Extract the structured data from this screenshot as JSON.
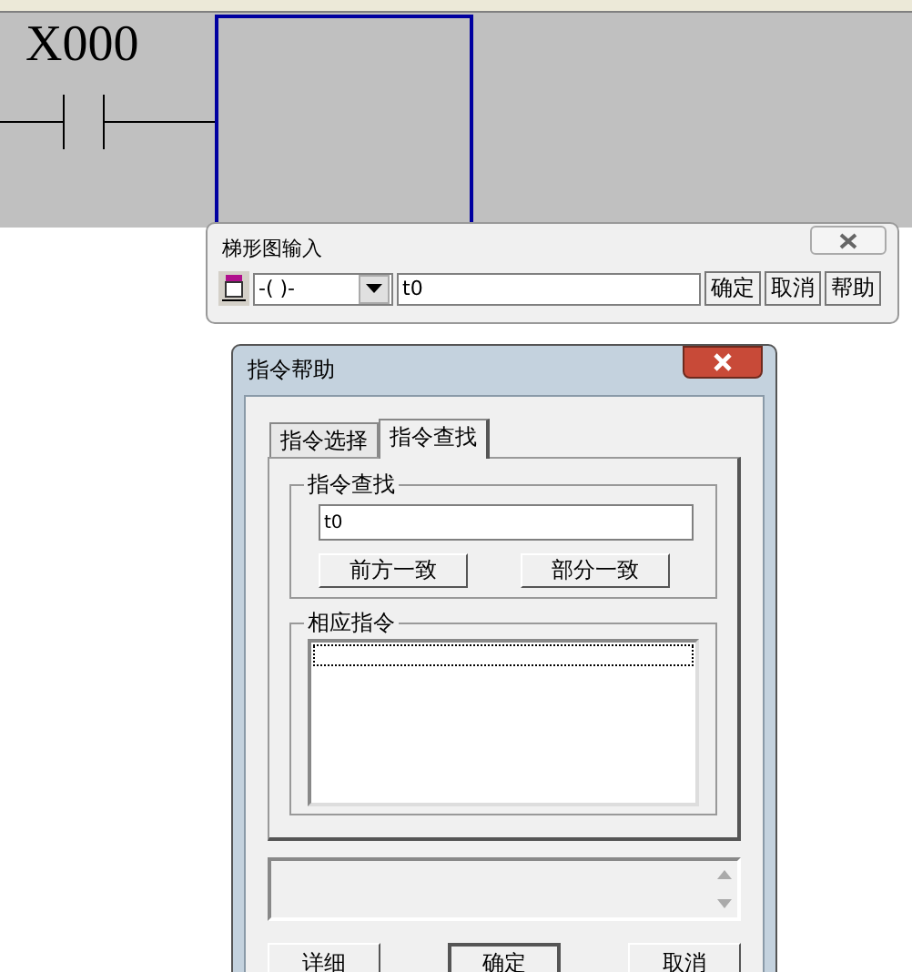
{
  "ladder": {
    "contact_label": "X000"
  },
  "input_dialog": {
    "title": "梯形图输入",
    "instruction": "-( )-",
    "value": "t0",
    "buttons": [
      "确定",
      "取消",
      "帮助"
    ]
  },
  "help_dialog": {
    "title": "指令帮助",
    "tabs": [
      {
        "label": "指令选择",
        "selected": false
      },
      {
        "label": "指令查找",
        "selected": true
      }
    ],
    "search_group": {
      "label": "指令查找",
      "value": "t0",
      "buttons": [
        "前方一致",
        "部分一致"
      ]
    },
    "result_group": {
      "label": "相应指令"
    },
    "buttons": [
      {
        "label": "详细",
        "default": false
      },
      {
        "label": "确定",
        "default": true
      },
      {
        "label": "取消",
        "default": false
      }
    ]
  }
}
